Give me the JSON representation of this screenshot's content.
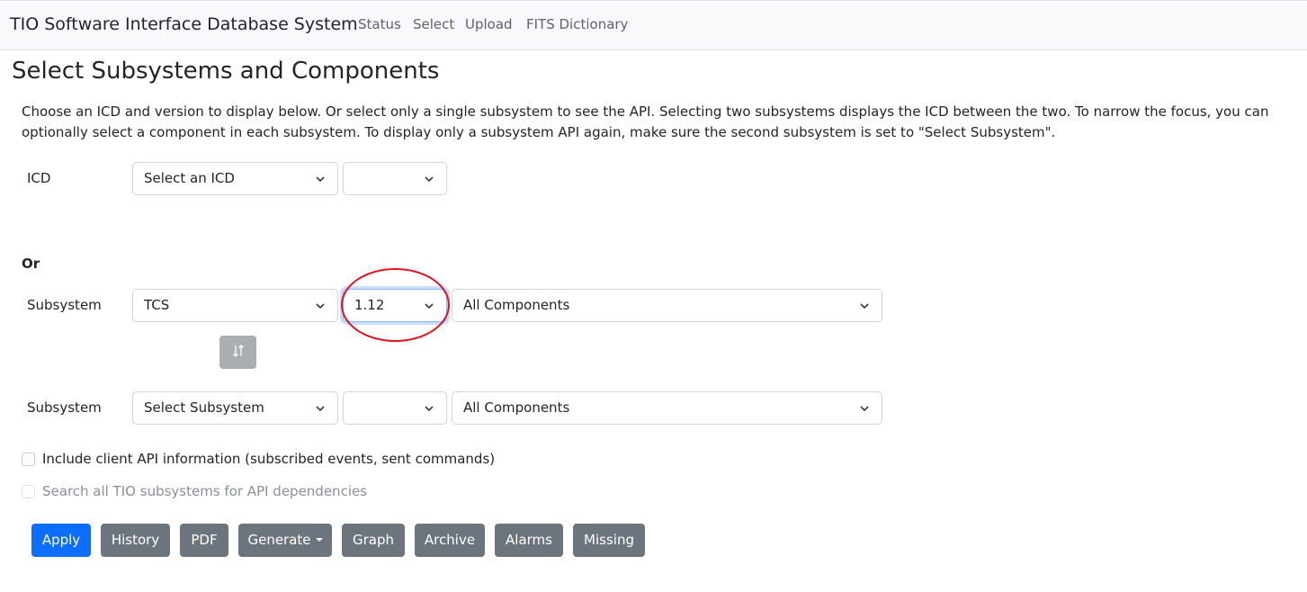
{
  "navbar": {
    "brand": "TIO Software Interface Database System",
    "links": [
      "Status",
      "Select",
      "Upload",
      "FITS Dictionary"
    ]
  },
  "page": {
    "title": "Select Subsystems and Components",
    "intro": "Choose an ICD and version to display below. Or select only a single subsystem to see the API. Selecting two subsystems displays the ICD between the two. To narrow the focus, you can optionally select a component in each subsystem. To display only a subsystem API again, make sure the second subsystem is set to \"Select Subsystem\"."
  },
  "icd": {
    "label": "ICD",
    "select_value": "Select an ICD",
    "version_value": ""
  },
  "or_label": "Or",
  "subsystem1": {
    "label": "Subsystem",
    "subsystem_value": "TCS",
    "version_value": "1.12",
    "component_value": "All Components"
  },
  "subsystem2": {
    "label": "Subsystem",
    "subsystem_value": "Select Subsystem",
    "version_value": "",
    "component_value": "All Components"
  },
  "options": {
    "client_api": "Include client API information (subscribed events, sent commands)",
    "search_all": "Search all TIO subsystems for API dependencies"
  },
  "buttons": {
    "apply": "Apply",
    "history": "History",
    "pdf": "PDF",
    "generate": "Generate",
    "graph": "Graph",
    "archive": "Archive",
    "alarms": "Alarms",
    "missing": "Missing"
  },
  "colors": {
    "primary": "#0d6efd",
    "secondary": "#6c757d",
    "annotation": "#e0141e"
  }
}
